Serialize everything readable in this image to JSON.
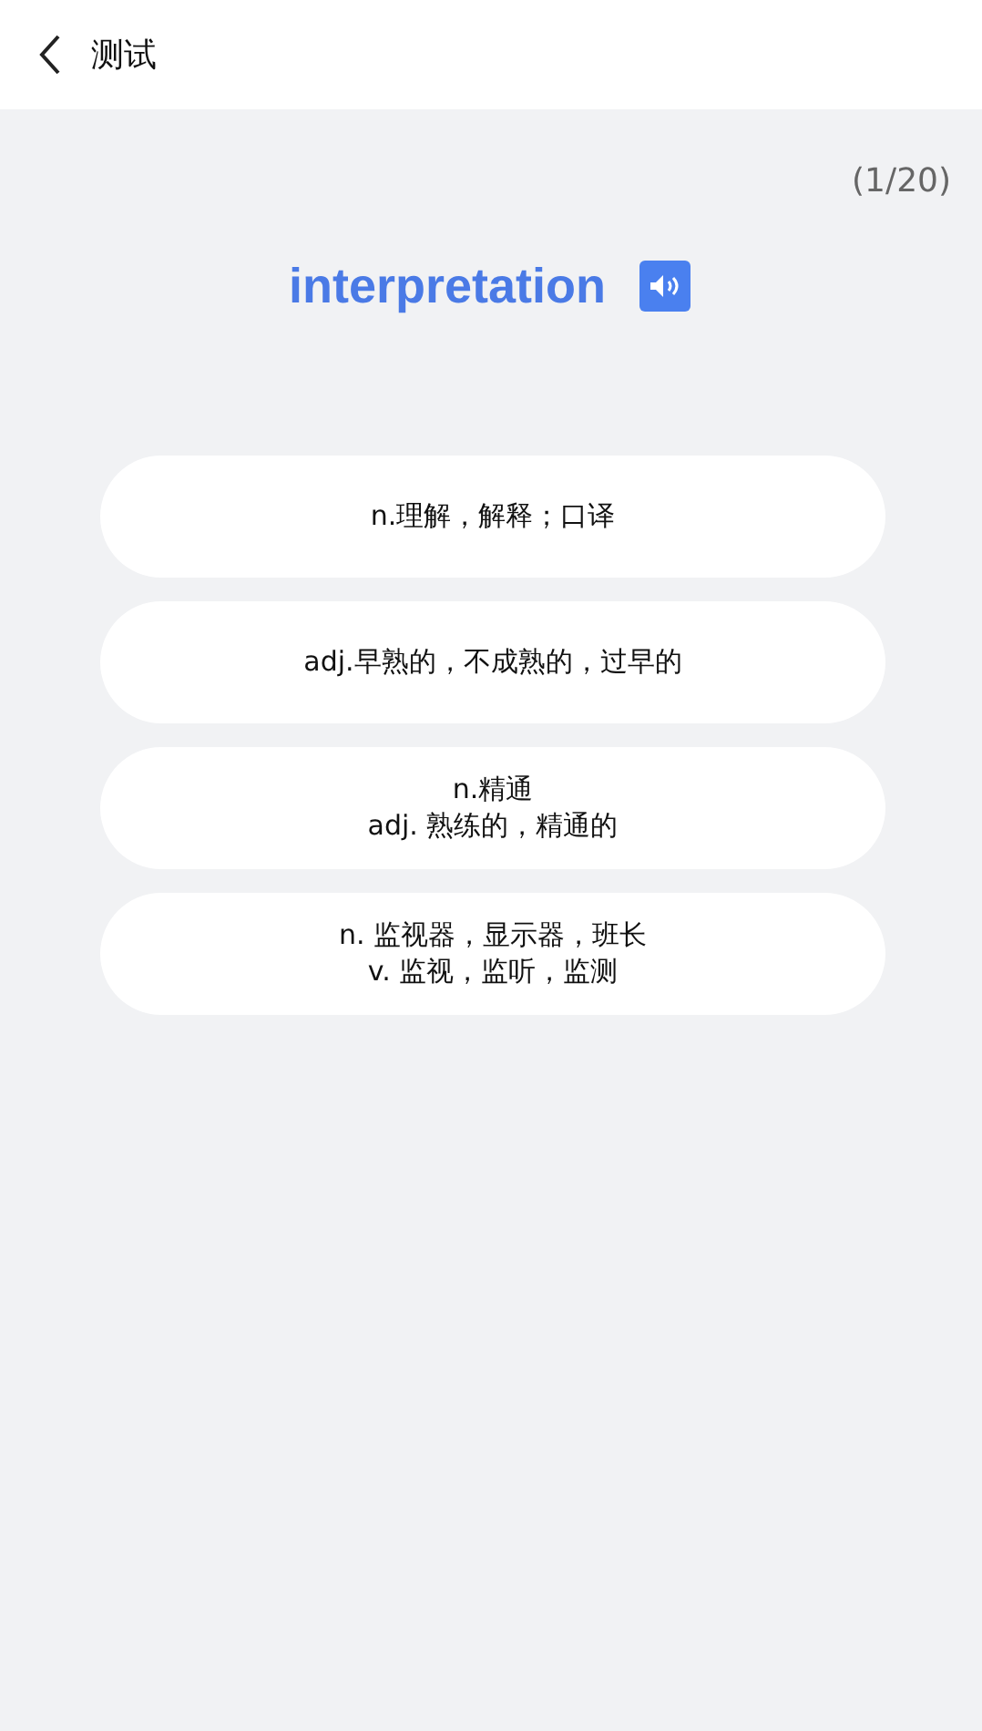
{
  "header": {
    "title": "测试"
  },
  "progress": "(1/20)",
  "word": "interpretation",
  "options": [
    {
      "lines": [
        "n.理解，解释；口译"
      ]
    },
    {
      "lines": [
        "adj.早熟的，不成熟的，过早的"
      ]
    },
    {
      "lines": [
        "n.精通",
        "adj. 熟练的，精通的"
      ]
    },
    {
      "lines": [
        "n. 监视器，显示器，班长",
        "v. 监视，监听，监测"
      ]
    }
  ]
}
